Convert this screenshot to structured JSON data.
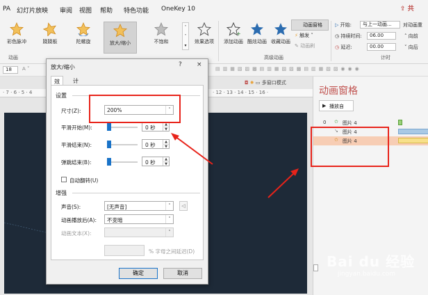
{
  "menubar": {
    "items": [
      "PA",
      "幻灯片放映",
      "审阅",
      "视图",
      "帮助",
      "特色功能",
      "OneKey 10"
    ],
    "share": "共"
  },
  "ribbon": {
    "effects": [
      {
        "label": "彩色脉冲",
        "icon": "pulse-star-icon",
        "color": "#e8a33c"
      },
      {
        "label": "跷跷板",
        "icon": "teeter-star-icon",
        "color": "#e8a33c"
      },
      {
        "label": "陀螺旋",
        "icon": "spin-star-icon",
        "color": "#e8a33c"
      },
      {
        "label": "放大/缩小",
        "icon": "grow-shrink-star-icon",
        "color": "#e8a33c"
      },
      {
        "label": "不饱和",
        "icon": "desaturate-star-icon",
        "color": "#9e9e9e"
      }
    ],
    "effect_options": "效果选项",
    "group_animation": "动画",
    "add_animation": "添加动画",
    "cool_animation": "酷炫动画",
    "collect_animation": "收藏动画",
    "group_advanced": "高级动画",
    "anim_pane": "动画窗格",
    "trigger": "触发",
    "anim_painter": "动画刷",
    "start_label": "开始:",
    "start_value": "与上一动画...",
    "duration_label": "持续时间:",
    "duration_value": "06.00",
    "delay_label": "延迟:",
    "delay_value": "00.00",
    "reorder_label": "对动画重",
    "move_earlier": "向前",
    "move_later": "向后",
    "group_timing": "计时"
  },
  "editor": {
    "ruler_left": "· 7 · 6 · 5 · 4",
    "ruler_right": "· 12 · 13 · 14 · 15 · 16 ·",
    "multiwindow": "多窗口模式",
    "font_size": "18"
  },
  "anim_pane": {
    "title": "动画窗格",
    "play_from": "播放自",
    "rows": [
      {
        "num": "0",
        "label": "图片 4",
        "icon": "star-icon",
        "bar_color": "#9ad07a",
        "selected": false
      },
      {
        "num": "",
        "label": "图片 4",
        "icon": "motion-icon",
        "bar_color": "#a9c9e4",
        "selected": false
      },
      {
        "num": "",
        "label": "图片 4",
        "icon": "star-icon",
        "bar_color": "#f7e08a",
        "selected": true
      }
    ]
  },
  "dialog": {
    "title": "放大/缩小",
    "help": "?",
    "close": "×",
    "tabs": [
      "效果",
      "计时"
    ],
    "settings_label": "设置",
    "size_label": "尺寸(Z):",
    "size_value": "200%",
    "smooth_start_label": "平滑开始(M):",
    "smooth_start_value": "0 秒",
    "smooth_end_label": "平滑结束(N):",
    "smooth_end_value": "0 秒",
    "bounce_end_label": "弹跳结束(B):",
    "bounce_end_value": "0 秒",
    "auto_reverse": "自动翻转(U)",
    "enhance_label": "增强",
    "sound_label": "声音(S):",
    "sound_value": "[无声音]",
    "after_anim_label": "动画播放后(A):",
    "after_anim_value": "不变暗",
    "anim_text_label": "动画文本(X):",
    "anim_text_value": "",
    "letter_delay": "% 字母之间延迟(D)",
    "ok": "确定",
    "cancel": "取消"
  },
  "annotations": {
    "highlight_color": "#e8231a"
  },
  "watermark": {
    "main": "Bai du 经验",
    "sub": "jingyan.baidu.com"
  }
}
